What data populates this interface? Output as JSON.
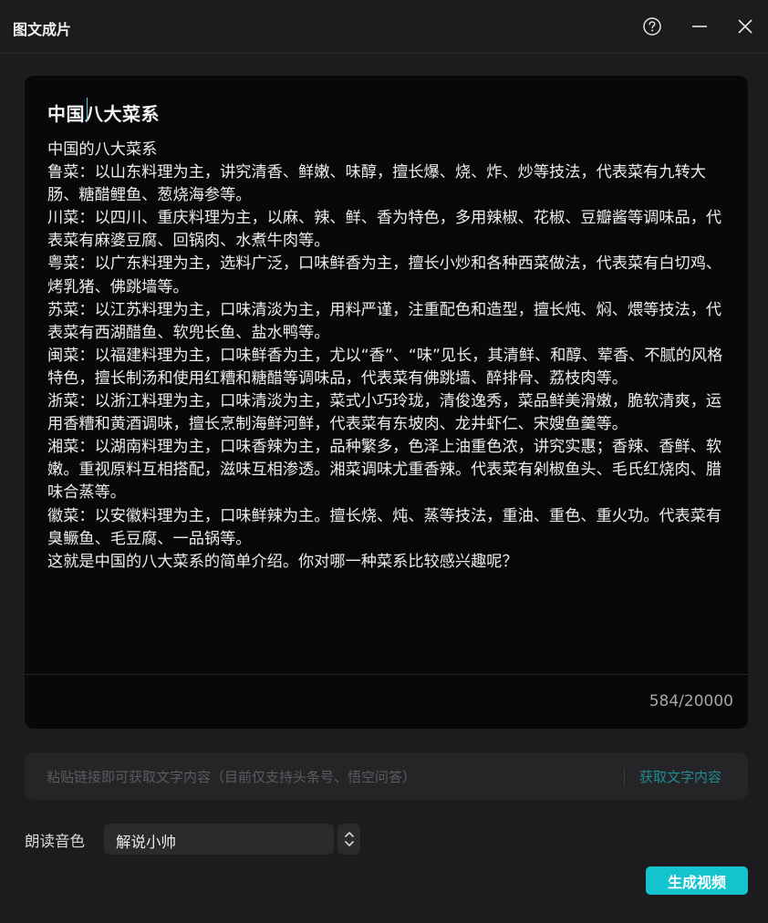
{
  "window": {
    "title": "图文成片"
  },
  "editor": {
    "heading": "中国八大菜系",
    "lines": [
      "中国的八大菜系",
      "鲁菜：以山东料理为主，讲究清香、鲜嫩、味醇，擅长爆、烧、炸、炒等技法，代表菜有九转大肠、糖醋鲤鱼、葱烧海参等。",
      "川菜：以四川、重庆料理为主，以麻、辣、鲜、香为特色，多用辣椒、花椒、豆瓣酱等调味品，代表菜有麻婆豆腐、回锅肉、水煮牛肉等。",
      "粤菜：以广东料理为主，选料广泛，口味鲜香为主，擅长小炒和各种西菜做法，代表菜有白切鸡、烤乳猪、佛跳墙等。",
      "苏菜：以江苏料理为主，口味清淡为主，用料严谨，注重配色和造型，擅长炖、焖、煨等技法，代表菜有西湖醋鱼、软兜长鱼、盐水鸭等。",
      "闽菜：以福建料理为主，口味鲜香为主，尤以“香”、“味”见长，其清鲜、和醇、荤香、不腻的风格特色，擅长制汤和使用红糟和糖醋等调味品，代表菜有佛跳墙、醉排骨、荔枝肉等。",
      "浙菜：以浙江料理为主，口味清淡为主，菜式小巧玲珑，清俊逸秀，菜品鲜美滑嫩，脆软清爽，运用香糟和黄酒调味，擅长烹制海鲜河鲜，代表菜有东坡肉、龙井虾仁、宋嫂鱼羹等。",
      "湘菜：以湖南料理为主，口味香辣为主，品种繁多，色泽上油重色浓，讲究实惠；香辣、香鲜、软嫩。重视原料互相搭配，滋味互相渗透。湘菜调味尤重香辣。代表菜有剁椒鱼头、毛氏红烧肉、腊味合蒸等。",
      "徽菜：以安徽料理为主，口味鲜辣为主。擅长烧、炖、蒸等技法，重油、重色、重火功。代表菜有臭鳜鱼、毛豆腐、一品锅等。",
      "这就是中国的八大菜系的简单介绍。你对哪一种菜系比较感兴趣呢？"
    ],
    "char_count": "584/20000"
  },
  "link": {
    "placeholder": "粘贴链接即可获取文字内容（目前仅支持头条号、悟空问答）",
    "action_label": "获取文字内容"
  },
  "voice": {
    "label": "朗读音色",
    "selected": "解说小帅"
  },
  "generate": {
    "label": "生成视频"
  },
  "colors": {
    "accent": "#13c4cf",
    "link_action": "#1f8b93",
    "editor_bg": "#08080a",
    "window_bg": "#1c1c1e"
  },
  "icons": {
    "help": "help-circle-icon",
    "minimize": "minimize-icon",
    "close": "close-icon",
    "stepper": "chevron-up-down-icon"
  }
}
